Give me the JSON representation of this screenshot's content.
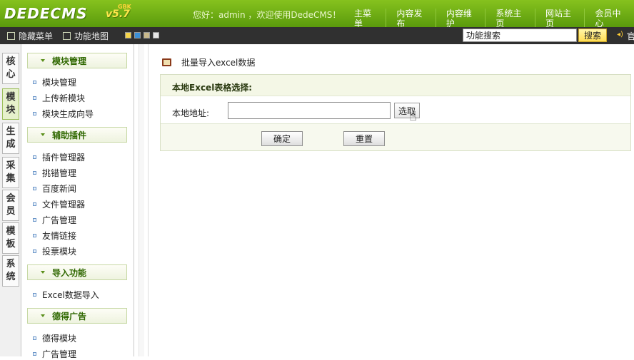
{
  "header": {
    "logo": "DEDECMS",
    "version": "v5.7",
    "edition": "GBK",
    "welcome": "您好：admin ，欢迎使用DedeCMS！",
    "nav": [
      "主菜单",
      "内容发布",
      "内容维护",
      "系统主页",
      "网站主页",
      "会员中心"
    ],
    "accent_color": "#6fae14"
  },
  "toolbar": {
    "hide_menu": "隐藏菜单",
    "site_map": "功能地图",
    "search_value": "功能搜索",
    "search_button": "搜索",
    "right_text": "官"
  },
  "vtabs": [
    {
      "label_top": "核",
      "label_bottom": "心",
      "active": false
    },
    {
      "label_top": "模",
      "label_bottom": "块",
      "active": true
    },
    {
      "label_top": "生",
      "label_bottom": "成",
      "active": false
    },
    {
      "label_top": "采",
      "label_bottom": "集",
      "active": false
    },
    {
      "label_top": "会",
      "label_bottom": "员",
      "active": false
    },
    {
      "label_top": "模",
      "label_bottom": "板",
      "active": false
    },
    {
      "label_top": "系",
      "label_bottom": "统",
      "active": false
    }
  ],
  "menu": {
    "sections": [
      {
        "title": "模块管理",
        "items": [
          "模块管理",
          "上传新模块",
          "模块生成向导"
        ]
      },
      {
        "title": "辅助插件",
        "items": [
          "插件管理器",
          "挑错管理",
          "百度新闻",
          "文件管理器",
          "广告管理",
          "友情链接",
          "投票模块"
        ]
      },
      {
        "title": "导入功能",
        "items": [
          "Excel数据导入"
        ]
      },
      {
        "title": "德得广告",
        "items": [
          "德得模块",
          "广告管理"
        ]
      }
    ]
  },
  "main": {
    "page_title": "批量导入excel数据",
    "form_header": "本地Excel表格选择:",
    "address_label": "本地地址:",
    "address_value": "",
    "choose_button": "选取",
    "ok_button": "确定",
    "reset_button": "重置"
  }
}
